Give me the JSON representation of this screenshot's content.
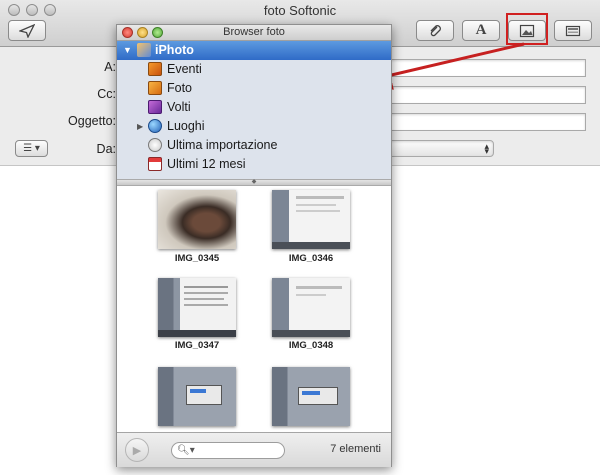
{
  "window": {
    "title": "foto Softonic"
  },
  "toolbar": {
    "send_icon": "paper-plane-icon",
    "attach_icon": "paperclip-icon",
    "fonts_label": "A",
    "photo_browser_icon": "photo-browser-icon",
    "stationery_icon": "stationery-icon"
  },
  "header_fields": {
    "to_label": "A:",
    "cc_label": "Cc:",
    "subject_label": "Oggetto:",
    "from_label": "Da:",
    "from_value": ""
  },
  "colors": {
    "highlight": "#d02020",
    "arrow": "#c62020",
    "selection": "#3b78d4"
  },
  "browser": {
    "title": "Browser foto",
    "sources": [
      {
        "label": "iPhoto",
        "icon": "iphoto-icon",
        "selected": true,
        "disclosure": "▼"
      },
      {
        "label": "Eventi",
        "icon": "events-icon"
      },
      {
        "label": "Foto",
        "icon": "photos-icon"
      },
      {
        "label": "Volti",
        "icon": "faces-icon"
      },
      {
        "label": "Luoghi",
        "icon": "places-globe-icon",
        "disclosure": "▶"
      },
      {
        "label": "Ultima importazione",
        "icon": "last-import-icon"
      },
      {
        "label": "Ultimi 12 mesi",
        "icon": "calendar-icon"
      }
    ],
    "photos": [
      {
        "caption": "IMG_0345"
      },
      {
        "caption": "IMG_0346"
      },
      {
        "caption": "IMG_0347"
      },
      {
        "caption": "IMG_0348"
      },
      {
        "caption": ""
      },
      {
        "caption": ""
      }
    ],
    "count_label": "7 elementi",
    "search_placeholder": ""
  }
}
